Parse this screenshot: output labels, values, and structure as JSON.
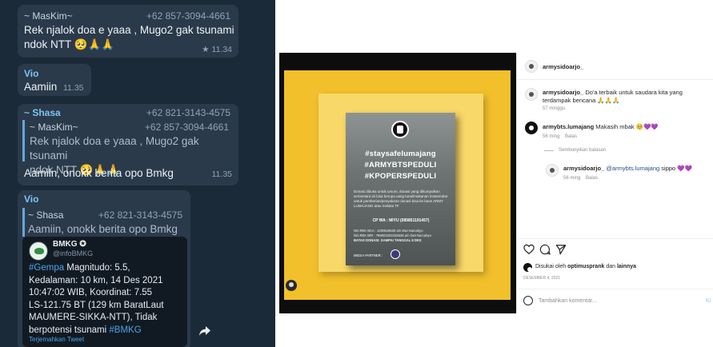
{
  "telegram": {
    "msg1": {
      "sender": "~ MasKim~",
      "phone": "+62 857-3094-4661",
      "text_line1": "Rek njalok doa e yaaa , Mugo2 gak tsunami",
      "text_line2": "ndok NTT 🥺🙏🙏",
      "time": "★ 11.34"
    },
    "msg2": {
      "sender": "Vio",
      "text": "Aamiin",
      "time": "11.35"
    },
    "msg3": {
      "sender": "~ Shasa",
      "phone": "+62 821-3143-4575",
      "quoted_sender": "~ MasKim~",
      "quoted_phone": "+62 857-3094-4661",
      "quoted_line1": "Rek njalok doa e yaaa , Mugo2 gak tsunami",
      "quoted_line2": "ndok NTT 🥺🙏🙏",
      "text": "Aamiin, onokk berita opo Bmkg",
      "time": "11.35"
    },
    "msg4": {
      "sender": "Vio",
      "quoted_sender": "~ Shasa",
      "quoted_phone": "+62 821-3143-4575",
      "quoted_text": "Aamiin, onokk berita opo Bmkg"
    },
    "tweet": {
      "name": "BMKG ✪",
      "handle": "@infoBMKG",
      "hashtag1": "#Gempa",
      "line1": " Magnitudo: 5.5,",
      "line2": "Kedalaman: 10 km, 14 Des 2021",
      "line3": "10:47:02 WIB, Koordinat: 7.55",
      "line4": "LS-121.75 BT (129 km BaratLaut",
      "line5": "MAUMERE-SIKKA-NTT), Tidak",
      "line6": "berpotensi tsunami ",
      "hashtag2": "#BMKG",
      "translate": "Terjemahkan Tweet"
    }
  },
  "instagram": {
    "poster": {
      "hashtag1": "#staysafelumajang",
      "hashtag2": "#ARMYBTSPEDULI",
      "hashtag3": "#KPOPERSPEDULI",
      "body": "Donasi dibuka untuk umum, donasi yang dikumpulkan sementara ini bisa berupa uang tunai/makanan instan/obat untuk pemberian/penyaluran donasi bisa ke base ARMY LUMAJANG atau melalui TF",
      "cp": "CP WA : MIYU (085851191457)",
      "acct1": "NO.REK BCA : 1200519520 a/n Dwi Nurcahyo",
      "acct2": "NO.REK BRI : 769001002432538 a/n Dwi Nurcahyo",
      "deadline": "BATAS DONASI: SAMPAI TANGGAL 8 DES",
      "media": "MEDIA PARTNER :"
    },
    "header_username": "armysidoarjo_",
    "caption": {
      "username": "armysidoarjo_",
      "text": "Do'a terbaik untuk saudara kita yang terdampak bencana 🙏🙏🙏",
      "time": "57 minggu"
    },
    "comment1": {
      "username": "armybts.lumajang",
      "text": "Makasih mbak 🥺💜💜",
      "time": "56 ming",
      "reply": "Balas"
    },
    "hide_replies": "Sembunyikan balasan",
    "comment2": {
      "username": "armysidoarjo_",
      "mention": "@armybts.lumajang",
      "text": "sippo 💜💜",
      "time": "56 ming",
      "reply": "Balas"
    },
    "liked_by_prefix": "Disukai oleh ",
    "liked_by_user": "optimusprank",
    "liked_by_mid": " dan ",
    "liked_by_others": "lainnya",
    "date": "DESEMBER 4, 2021",
    "comment_placeholder": "Tambahkan komentar...",
    "post_button": "Ki",
    "heart_color": "#7a4fd1"
  }
}
